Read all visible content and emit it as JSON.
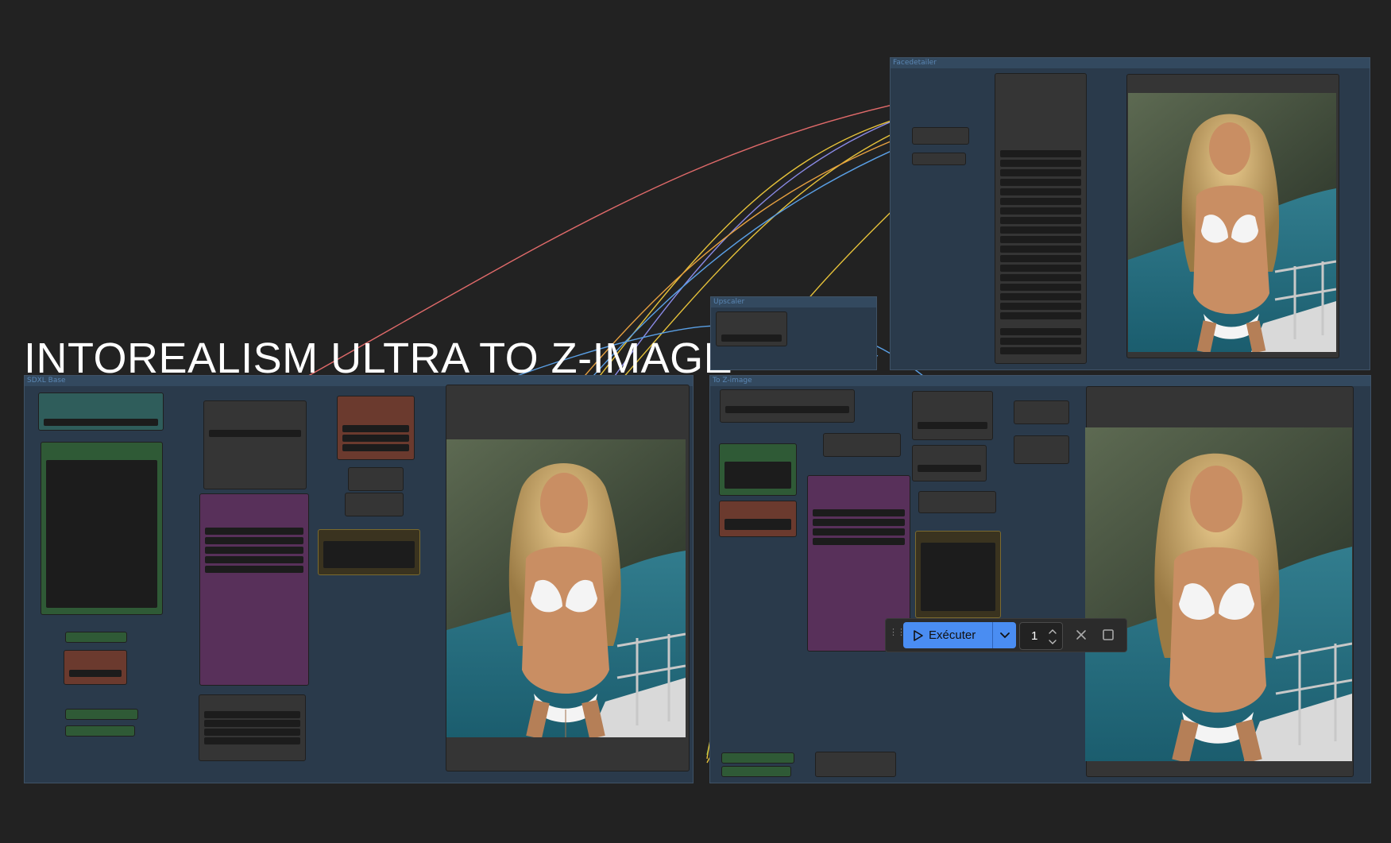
{
  "canvas_title": "INTOREALISM ULTRA TO Z-IMAGE",
  "groups": {
    "sdxl": "SDXL Base",
    "to_z": "To Z-image",
    "upscaler": "Upscaler",
    "facedetailer": "Facedetailer"
  },
  "toolbar": {
    "run_label": "Exécuter",
    "batch_count": "1"
  },
  "icons": [
    "drag-handle-icon",
    "play-icon",
    "chevron-down-icon",
    "increment-icon",
    "decrement-icon",
    "close-icon",
    "stop-icon"
  ],
  "colors": {
    "background": "#222222",
    "group_fill": "#2a3a4b",
    "run_button": "#4a8df2",
    "node_purple": "#58305a",
    "node_green": "#2f5a36",
    "node_brown": "#6b3a2e",
    "node_teal": "#2f5d5b"
  }
}
